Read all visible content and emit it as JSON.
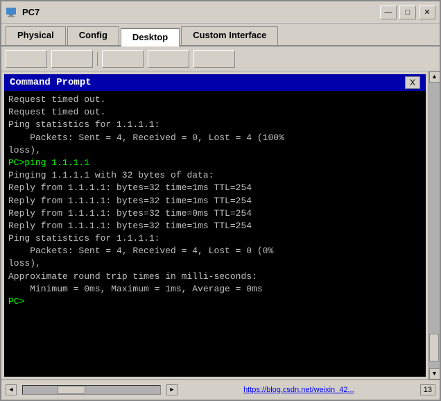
{
  "window": {
    "title": "PC7",
    "icon": "pc-icon",
    "min_label": "—",
    "max_label": "□",
    "close_label": "✕"
  },
  "tabs": [
    {
      "id": "physical",
      "label": "Physical"
    },
    {
      "id": "config",
      "label": "Config"
    },
    {
      "id": "desktop",
      "label": "Desktop",
      "active": true
    },
    {
      "id": "custom",
      "label": "Custom Interface"
    }
  ],
  "cmd": {
    "title": "Command Prompt",
    "close_label": "X",
    "lines": [
      "Request timed out.",
      "Request timed out.",
      "",
      "Ping statistics for 1.1.1.1:",
      "    Packets: Sent = 4, Received = 0, Lost = 4 (100%",
      "loss),",
      "",
      "PC>ping 1.1.1.1",
      "",
      "Pinging 1.1.1.1 with 32 bytes of data:",
      "",
      "Reply from 1.1.1.1: bytes=32 time=1ms TTL=254",
      "Reply from 1.1.1.1: bytes=32 time=1ms TTL=254",
      "Reply from 1.1.1.1: bytes=32 time=0ms TTL=254",
      "Reply from 1.1.1.1: bytes=32 time=1ms TTL=254",
      "",
      "Ping statistics for 1.1.1.1:",
      "    Packets: Sent = 4, Received = 4, Lost = 0 (0%",
      "loss),",
      "Approximate round trip times in milli-seconds:",
      "    Minimum = 0ms, Maximum = 1ms, Average = 0ms",
      "",
      "PC>"
    ]
  },
  "status": {
    "url": "https://blog.csdn.net/weixin_42...",
    "page": "13"
  }
}
